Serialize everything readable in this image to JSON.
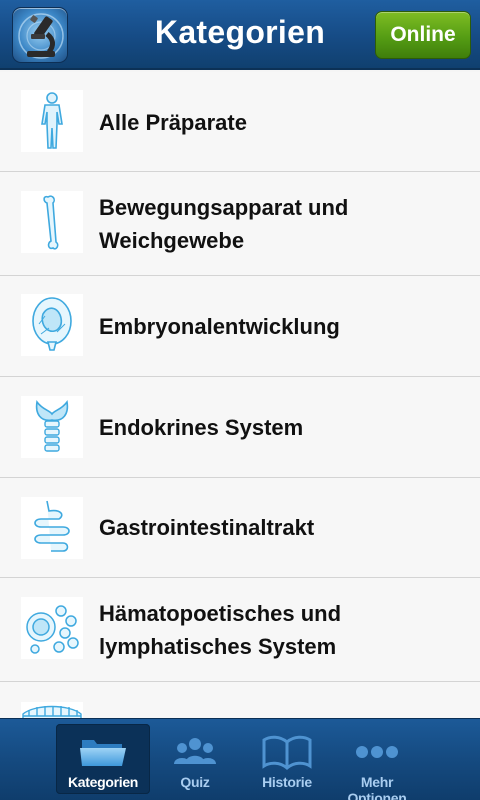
{
  "header": {
    "title": "Kategorien",
    "online_button": "Online",
    "app_icon": "microscope-icon"
  },
  "categories": [
    {
      "line1": "Alle Präparate",
      "line2": "",
      "icon": "human-body-icon"
    },
    {
      "line1": "Bewegungsapparat und",
      "line2": "Weichgewebe",
      "icon": "bone-icon"
    },
    {
      "line1": "Embryonalentwicklung",
      "line2": "",
      "icon": "embryo-icon"
    },
    {
      "line1": "Endokrines System",
      "line2": "",
      "icon": "thyroid-icon"
    },
    {
      "line1": "Gastrointestinaltrakt",
      "line2": "",
      "icon": "intestine-icon"
    },
    {
      "line1": "Hämatopoetisches und",
      "line2": "lymphatisches System",
      "icon": "blood-cells-icon"
    },
    {
      "line1": "",
      "line2": "",
      "icon": "tissue-icon"
    }
  ],
  "tabs": [
    {
      "label": "Kategorien",
      "icon": "folder-icon",
      "active": true
    },
    {
      "label": "Quiz",
      "icon": "people-icon",
      "active": false
    },
    {
      "label": "Historie",
      "icon": "book-icon",
      "active": false
    },
    {
      "label": "Mehr Optionen",
      "icon": "more-dots-icon",
      "active": false
    }
  ],
  "colors": {
    "header_blue": "#164b85",
    "online_green": "#559d14",
    "icon_blue": "#7cc7ec",
    "tab_label_inactive": "#a9cdf0"
  }
}
